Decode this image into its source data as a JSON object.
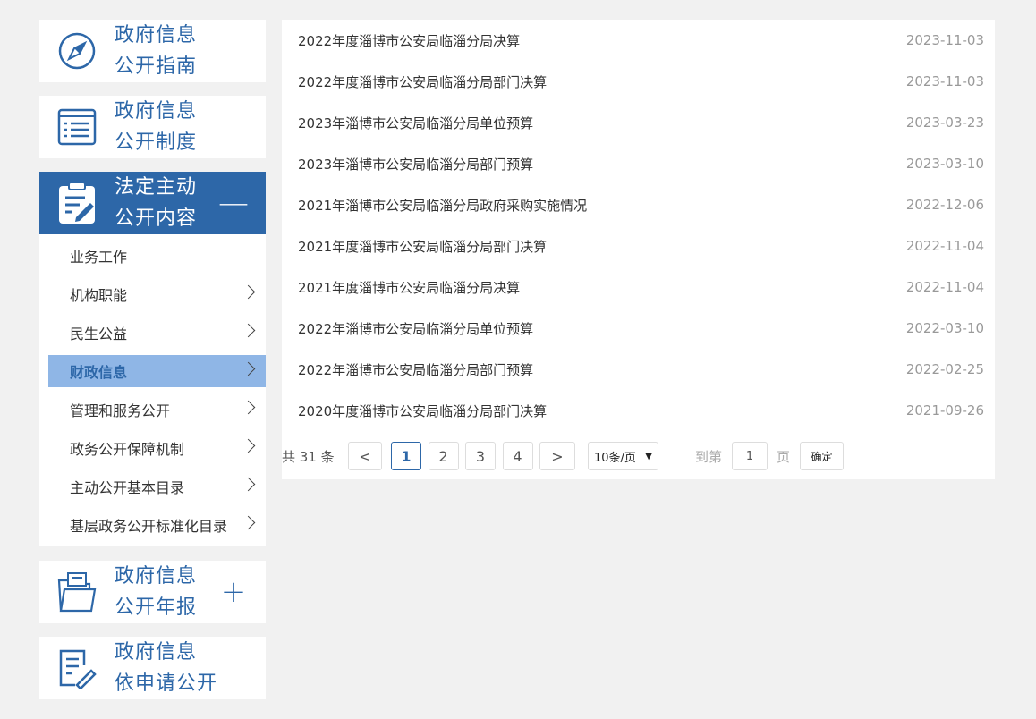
{
  "sidebar": {
    "blocks": [
      {
        "line1": "政府信息",
        "line2": "公开指南",
        "icon": "compass-icon"
      },
      {
        "line1": "政府信息",
        "line2": "公开制度",
        "icon": "list-icon"
      },
      {
        "line1": "法定主动",
        "line2": "公开内容",
        "icon": "clipboard-edit-icon",
        "toggle": "—"
      },
      {
        "line1": "政府信息",
        "line2": "公开年报",
        "icon": "folder-icon",
        "toggle": "+"
      },
      {
        "line1": "政府信息",
        "line2": "依申请公开",
        "icon": "edit-doc-icon"
      }
    ],
    "sub_items": [
      {
        "label": "业务工作",
        "chevron": false
      },
      {
        "label": "机构职能",
        "chevron": true
      },
      {
        "label": "民生公益",
        "chevron": true
      },
      {
        "label": "财政信息",
        "chevron": true,
        "active": true
      },
      {
        "label": "管理和服务公开",
        "chevron": true
      },
      {
        "label": "政务公开保障机制",
        "chevron": true
      },
      {
        "label": "主动公开基本目录",
        "chevron": true
      },
      {
        "label": "基层政务公开标准化目录",
        "chevron": true
      }
    ],
    "accent": "#2d67a8",
    "active_sub_bg": "#8fb6e6"
  },
  "list": [
    {
      "title": "2022年度淄博市公安局临淄分局决算",
      "date": "2023-11-03"
    },
    {
      "title": "2022年度淄博市公安局临淄分局部门决算",
      "date": "2023-11-03"
    },
    {
      "title": "2023年淄博市公安局临淄分局单位预算",
      "date": "2023-03-23"
    },
    {
      "title": "2023年淄博市公安局临淄分局部门预算",
      "date": "2023-03-10"
    },
    {
      "title": "2021年淄博市公安局临淄分局政府采购实施情况",
      "date": "2022-12-06"
    },
    {
      "title": "2021年度淄博市公安局临淄分局部门决算",
      "date": "2022-11-04"
    },
    {
      "title": "2021年度淄博市公安局临淄分局决算",
      "date": "2022-11-04"
    },
    {
      "title": "2022年淄博市公安局临淄分局单位预算",
      "date": "2022-03-10"
    },
    {
      "title": "2022年淄博市公安局临淄分局部门预算",
      "date": "2022-02-25"
    },
    {
      "title": "2020年度淄博市公安局临淄分局部门决算",
      "date": "2021-09-26"
    }
  ],
  "pagination": {
    "total": "共 31 条",
    "prev": "<",
    "pages": [
      "1",
      "2",
      "3",
      "4"
    ],
    "current": "1",
    "next": ">",
    "page_size": "10条/页",
    "goto_label": "到第",
    "goto_value": "1",
    "page_unit": "页",
    "confirm": "确定"
  }
}
